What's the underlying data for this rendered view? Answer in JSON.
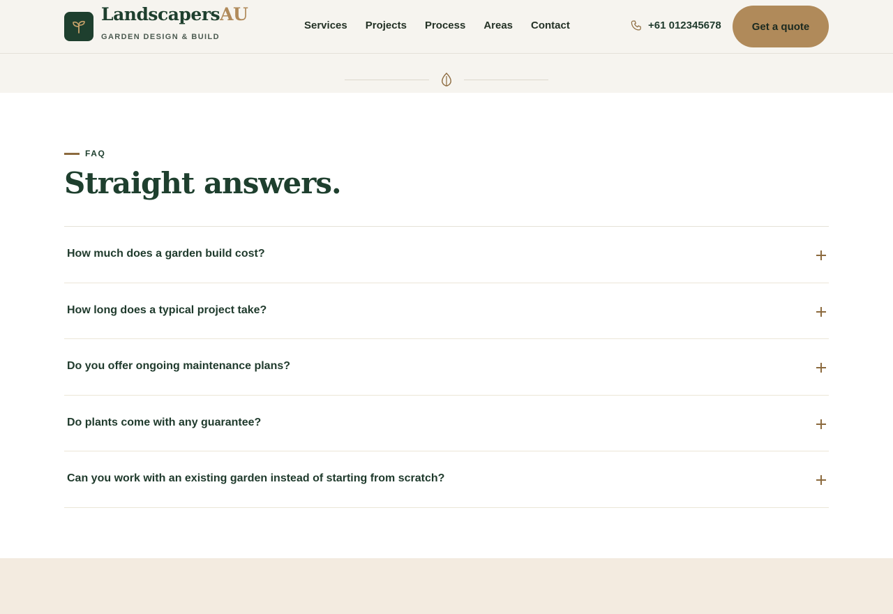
{
  "header": {
    "brand_name_main": "Landscapers",
    "brand_name_accent": "AU",
    "tagline": "GARDEN DESIGN & BUILD",
    "nav": [
      "Services",
      "Projects",
      "Process",
      "Areas",
      "Contact"
    ],
    "phone": "+61 012345678",
    "cta_label": "Get a quote"
  },
  "faq": {
    "eyebrow": "FAQ",
    "title": "Straight answers.",
    "items": [
      "How much does a garden build cost?",
      "How long does a typical project take?",
      "Do you offer ongoing maintenance plans?",
      "Do plants come with any guarantee?",
      "Can you work with an existing garden instead of starting from scratch?"
    ]
  },
  "colors": {
    "brand_green": "#1e3f2e",
    "accent_tan": "#b08a5a",
    "header_bg": "#f6f4ef",
    "footer_bg": "#f3ebe0"
  },
  "icons": {
    "logo": "sprout-icon",
    "phone": "phone-icon",
    "divider": "leaf-icon",
    "faq_toggle": "plus-icon"
  }
}
